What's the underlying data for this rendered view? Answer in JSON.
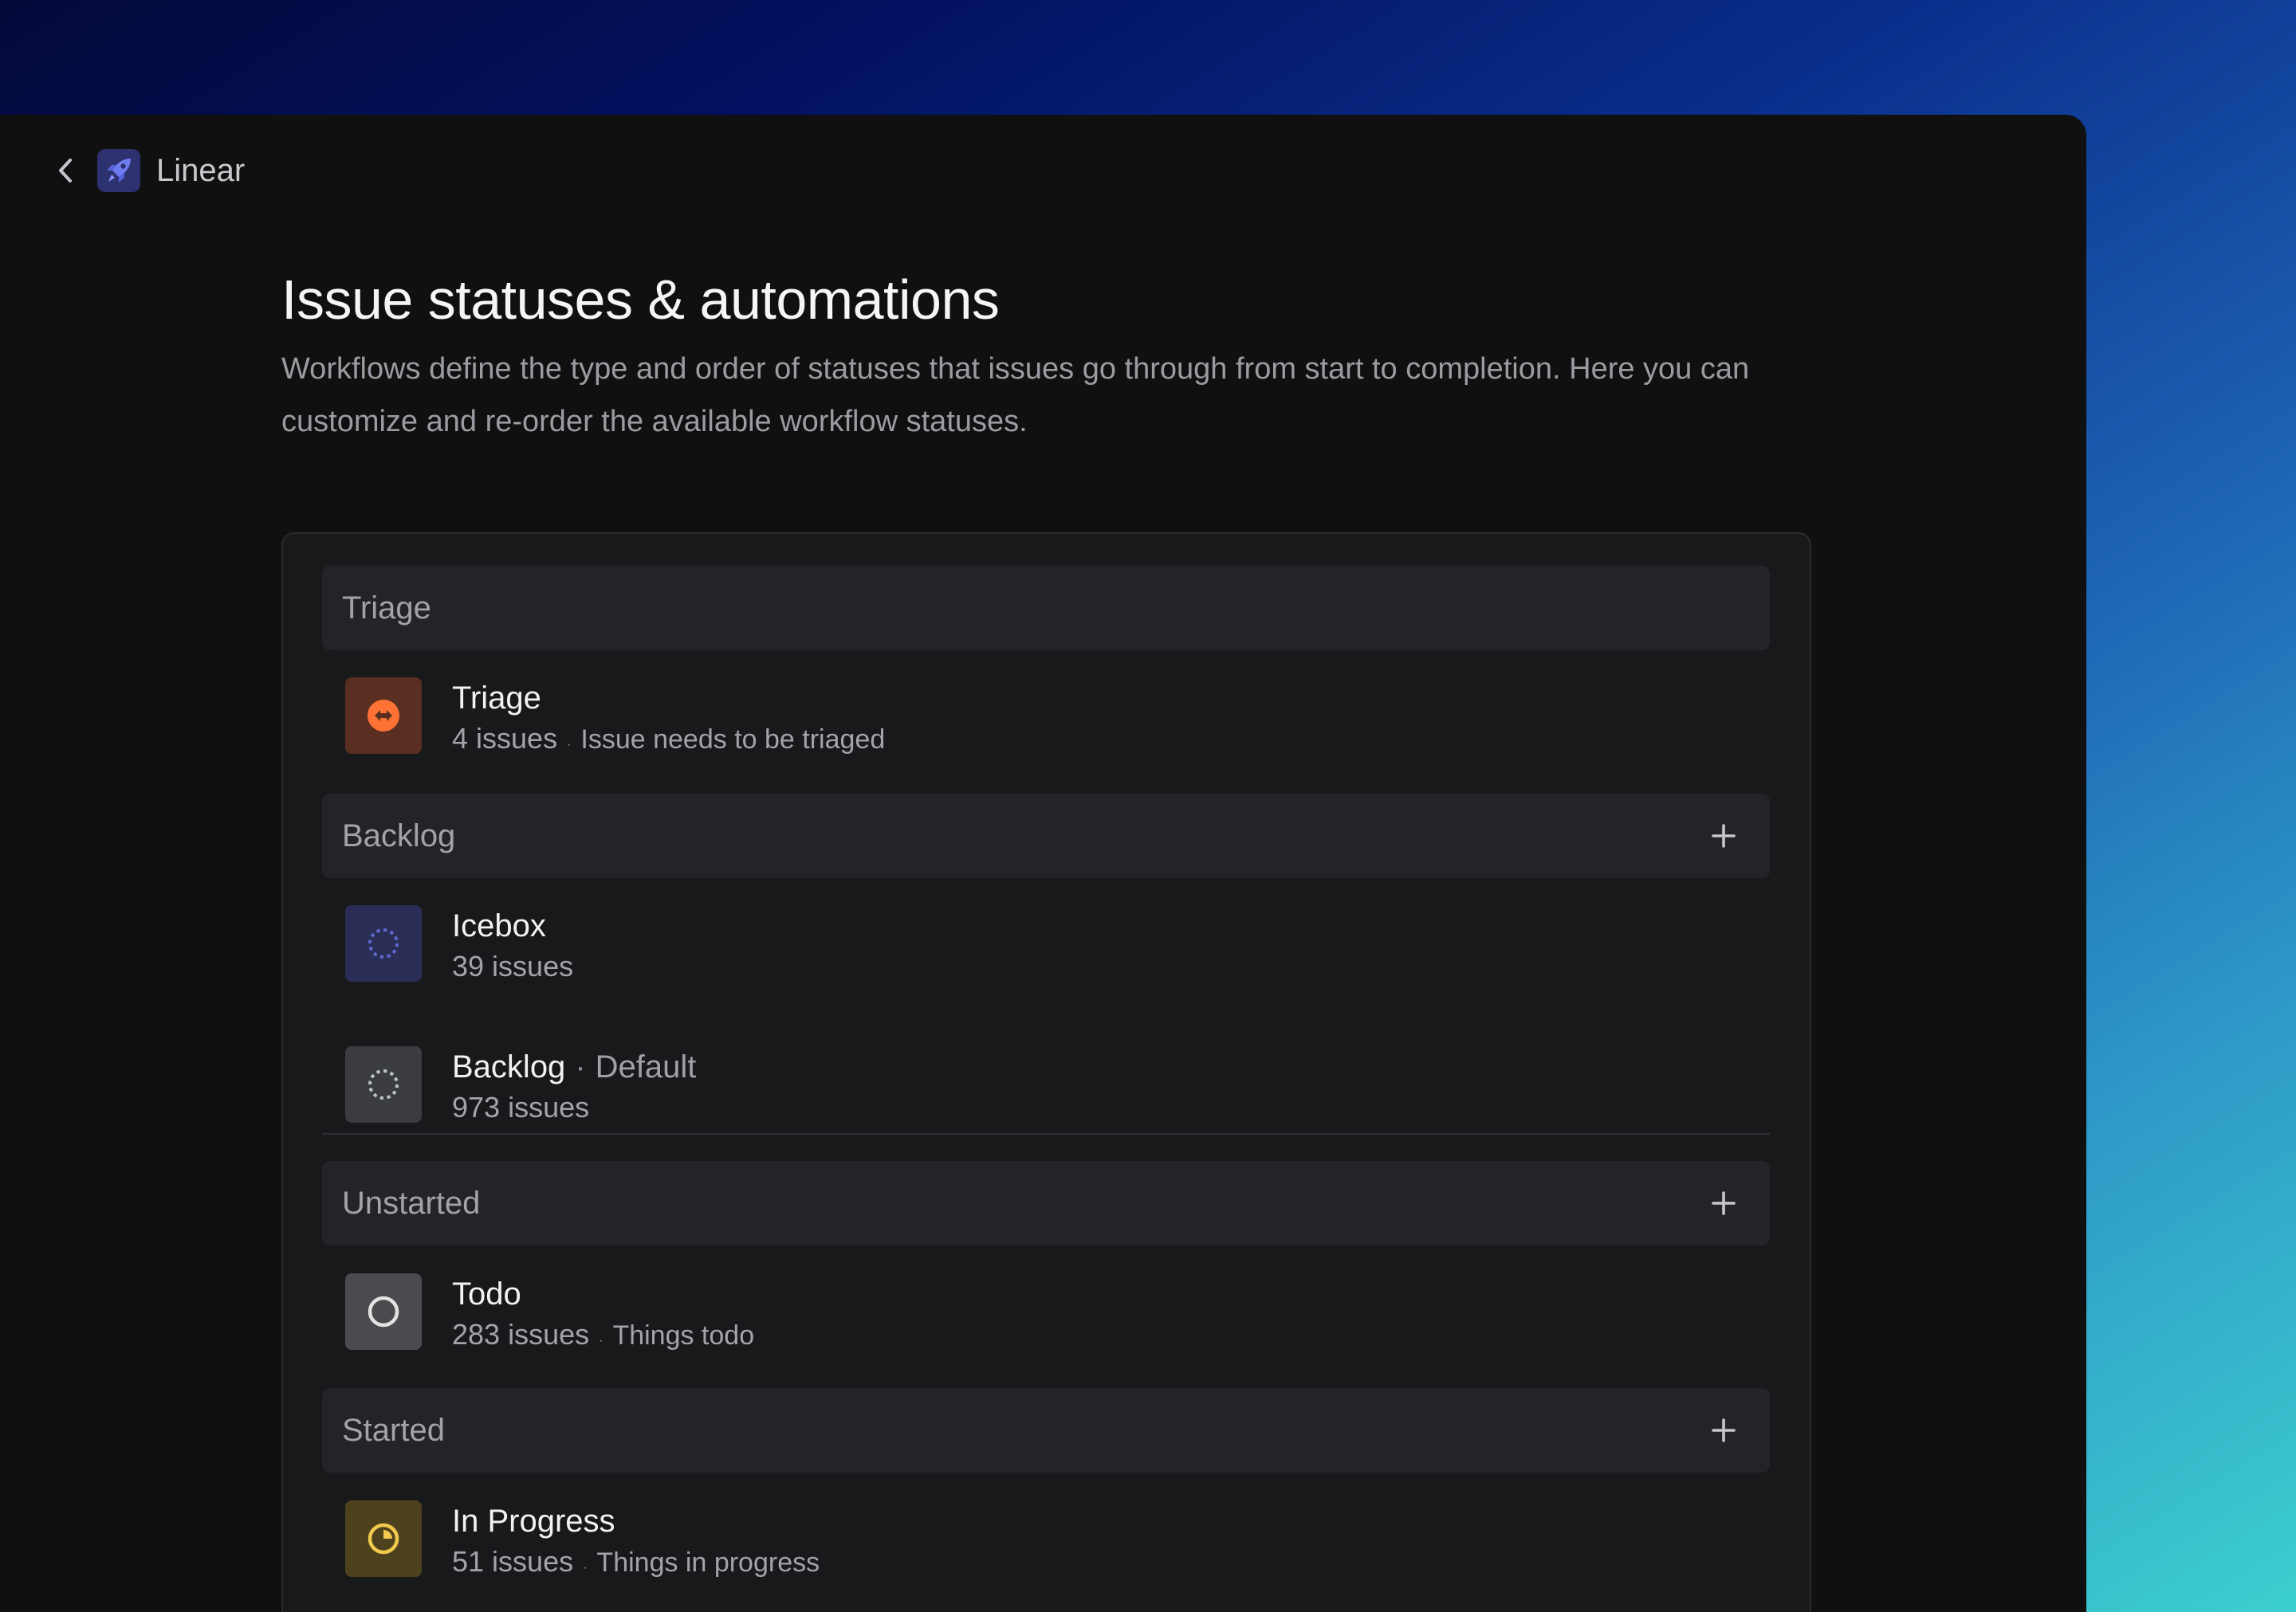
{
  "breadcrumb": {
    "workspace_name": "Linear"
  },
  "page": {
    "title": "Issue statuses & automations",
    "description": "Workflows define the type and order of statuses that issues go through from start to completion. Here you can customize and re-order the available workflow statuses."
  },
  "groups": [
    {
      "label": "Triage",
      "has_add_button": false,
      "statuses": [
        {
          "name": "Triage",
          "tag": "",
          "count": "4 issues",
          "description": "Issue needs to be triaged",
          "icon": "triage-icon",
          "color": "#ff7236"
        }
      ]
    },
    {
      "label": "Backlog",
      "has_add_button": true,
      "statuses": [
        {
          "name": "Icebox",
          "tag": "",
          "count": "39 issues",
          "description": "",
          "icon": "icebox-dotted-circle-icon",
          "color": "#5e6ad2"
        },
        {
          "name": "Backlog",
          "tag": "Default",
          "count": "973 issues",
          "description": "",
          "icon": "backlog-dotted-circle-icon",
          "color": "#bec2c8"
        }
      ]
    },
    {
      "label": "Unstarted",
      "has_add_button": true,
      "statuses": [
        {
          "name": "Todo",
          "tag": "",
          "count": "283 issues",
          "description": "Things todo",
          "icon": "todo-circle-icon",
          "color": "#e2e2e2"
        }
      ]
    },
    {
      "label": "Started",
      "has_add_button": true,
      "statuses": [
        {
          "name": "In Progress",
          "tag": "",
          "count": "51 issues",
          "description": "Things in progress",
          "icon": "in-progress-icon",
          "color": "#f2c94c"
        }
      ]
    }
  ],
  "colors": {
    "window_bg": "#101011",
    "panel_bg": "#18191b",
    "group_header_bg": "#232428",
    "accent": "#5e6ad2"
  }
}
